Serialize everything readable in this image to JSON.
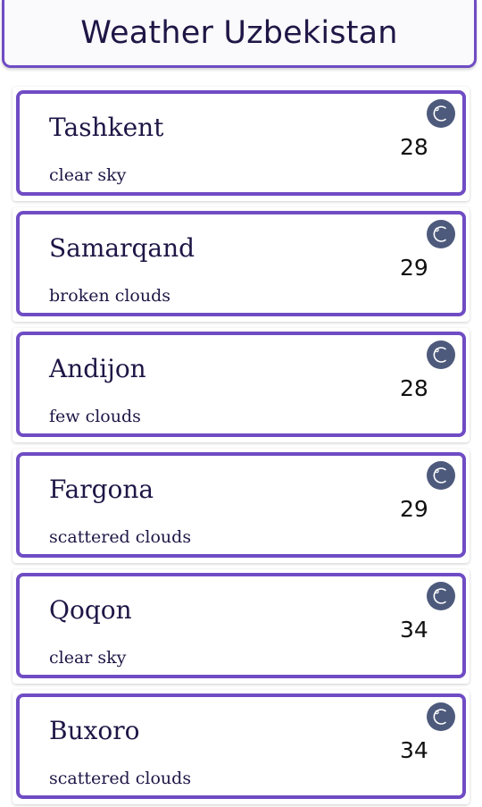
{
  "header": {
    "title": "Weather Uzbekistan"
  },
  "cities": [
    {
      "name": "Tashkent",
      "description": "clear sky",
      "temp": "28",
      "icon": "night-moon-icon"
    },
    {
      "name": "Samarqand",
      "description": "broken clouds",
      "temp": "29",
      "icon": "night-moon-icon"
    },
    {
      "name": "Andijon",
      "description": "few clouds",
      "temp": "28",
      "icon": "night-moon-icon"
    },
    {
      "name": "Fargona",
      "description": "scattered clouds",
      "temp": "29",
      "icon": "night-moon-icon"
    },
    {
      "name": "Qoqon",
      "description": "clear sky",
      "temp": "34",
      "icon": "night-moon-icon"
    },
    {
      "name": "Buxoro",
      "description": "scattered clouds",
      "temp": "34",
      "icon": "night-moon-icon"
    }
  ],
  "colors": {
    "accent": "#6f4cc4",
    "text": "#1f1646",
    "icon_bg": "#4d5a7c"
  }
}
